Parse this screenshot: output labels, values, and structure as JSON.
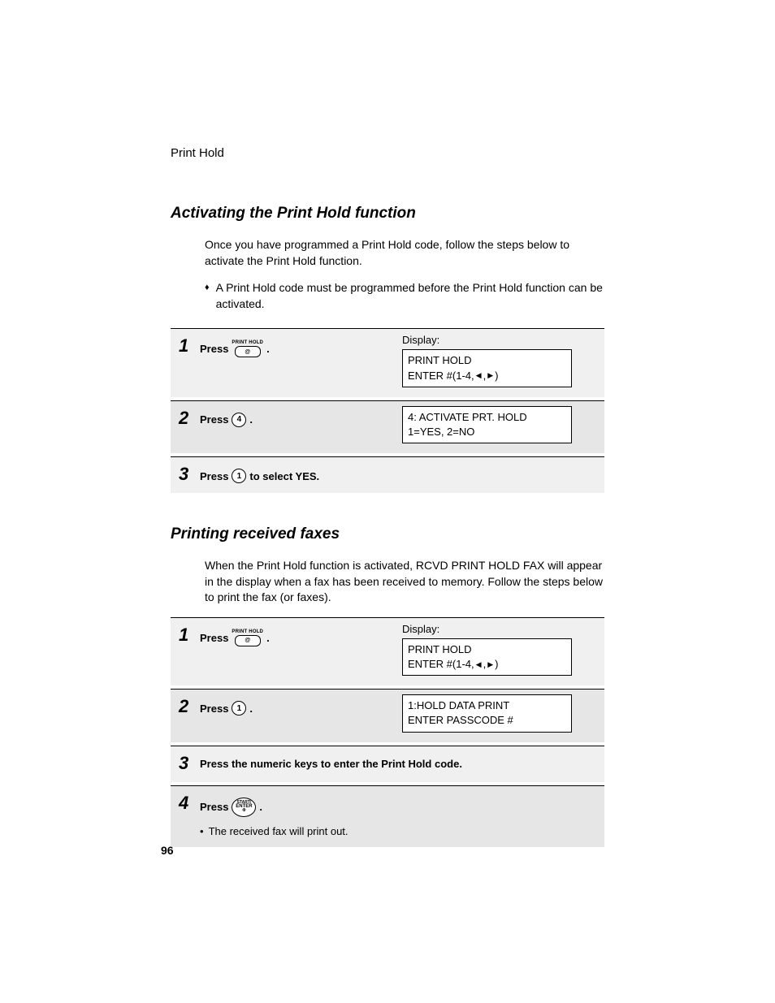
{
  "header": "Print Hold",
  "pageNumber": "96",
  "section1": {
    "heading": "Activating the Print Hold function",
    "intro": "Once you have programmed a Print Hold code, follow the steps below to activate the Print Hold function.",
    "bullet": "A Print Hold code must be programmed before the Print Hold function can be activated.",
    "displayLabel": "Display:",
    "steps": {
      "s1": {
        "num": "1",
        "pre": "Press",
        "btnLabel": "PRINT HOLD",
        "btnSymbol": "@",
        "post": ".",
        "display": {
          "line1": "PRINT HOLD",
          "line2pre": "ENTER #(1-4,",
          "line2post": ")"
        }
      },
      "s2": {
        "num": "2",
        "pre": "Press",
        "key": "4",
        "post": ".",
        "display": {
          "line1": "4: ACTIVATE PRT. HOLD",
          "line2": "1=YES, 2=NO"
        }
      },
      "s3": {
        "num": "3",
        "pre": "Press",
        "key": "1",
        "post": "to select YES."
      }
    }
  },
  "section2": {
    "heading": "Printing received faxes",
    "intro": "When the Print Hold function is activated, RCVD PRINT HOLD FAX will appear in the display when a fax has been received to memory. Follow the steps below to print the fax (or faxes).",
    "displayLabel": "Display:",
    "steps": {
      "s1": {
        "num": "1",
        "pre": "Press",
        "btnLabel": "PRINT HOLD",
        "btnSymbol": "@",
        "post": ".",
        "display": {
          "line1": "PRINT HOLD",
          "line2pre": "ENTER #(1-4,",
          "line2post": ")"
        }
      },
      "s2": {
        "num": "2",
        "pre": "Press",
        "key": "1",
        "post": ".",
        "display": {
          "line1": "1:HOLD DATA PRINT",
          "line2": "ENTER PASSCODE #"
        }
      },
      "s3": {
        "num": "3",
        "text": "Press the numeric keys to enter the Print Hold code."
      },
      "s4": {
        "num": "4",
        "pre": "Press",
        "btnT1": "START/",
        "btnT2": "ENTER",
        "post": ".",
        "sub": "The received fax will print out."
      }
    }
  }
}
